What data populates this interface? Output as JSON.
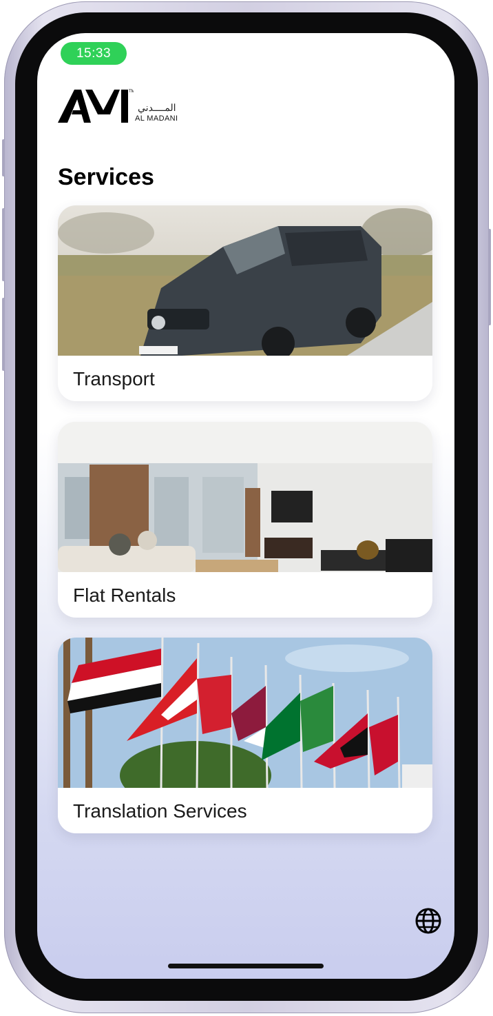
{
  "status_bar": {
    "time": "15:33"
  },
  "brand": {
    "arabic_name": "المــــدني",
    "latin_name": "AL MADANI"
  },
  "page": {
    "title": "Services"
  },
  "services": [
    {
      "label": "Transport",
      "image": "van-photo"
    },
    {
      "label": "Flat Rentals",
      "image": "apartment-photo"
    },
    {
      "label": "Translation Services",
      "image": "flags-photo"
    }
  ],
  "icons": {
    "language": "globe-icon"
  },
  "colors": {
    "status_pill": "#2fd158",
    "gradient_bottom": "#c9cdee"
  }
}
